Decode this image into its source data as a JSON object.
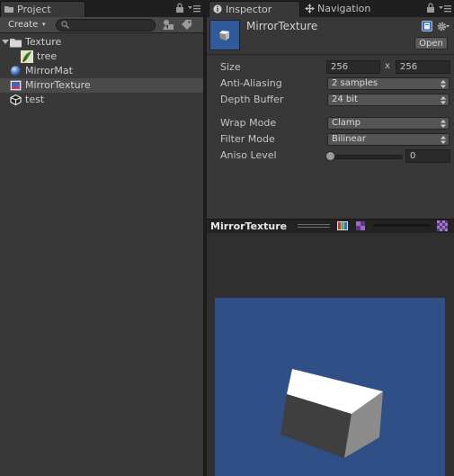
{
  "project_panel": {
    "tab_label": "Project",
    "create_label": "Create",
    "create_arrow": "▾",
    "search_value": "",
    "tree": [
      {
        "label": "Texture",
        "icon": "folder-icon",
        "depth": 0,
        "expanded": true,
        "selected": false
      },
      {
        "label": "tree",
        "icon": "texture-thumbnail-icon",
        "depth": 1,
        "expanded": false,
        "selected": false
      },
      {
        "label": "MirrorMat",
        "icon": "material-sphere-icon",
        "depth": 0,
        "expanded": false,
        "selected": false
      },
      {
        "label": "MirrorTexture",
        "icon": "render-texture-icon",
        "depth": 0,
        "expanded": false,
        "selected": true
      },
      {
        "label": "test",
        "icon": "unity-scene-icon",
        "depth": 0,
        "expanded": false,
        "selected": false
      }
    ]
  },
  "inspector": {
    "tab_label": "Inspector",
    "nav_tab_label": "Navigation",
    "asset_title": "MirrorTexture",
    "open_label": "Open",
    "size_label": "Size",
    "size_width": "256",
    "size_separator": "x",
    "size_height": "256",
    "anti_aliasing_label": "Anti-Aliasing",
    "anti_aliasing_value": "2 samples",
    "depth_buffer_label": "Depth Buffer",
    "depth_buffer_value": "24 bit",
    "wrap_mode_label": "Wrap Mode",
    "wrap_mode_value": "Clamp",
    "filter_mode_label": "Filter Mode",
    "filter_mode_value": "Bilinear",
    "aniso_level_label": "Aniso Level",
    "aniso_level_value": "0"
  },
  "preview": {
    "title": "MirrorTexture",
    "background_color": "#2f4f86"
  },
  "colors": {
    "panel_bg": "#383838",
    "selection_bg": "#4a4a4a",
    "thumbnail_blue": "#2f5b9d"
  }
}
